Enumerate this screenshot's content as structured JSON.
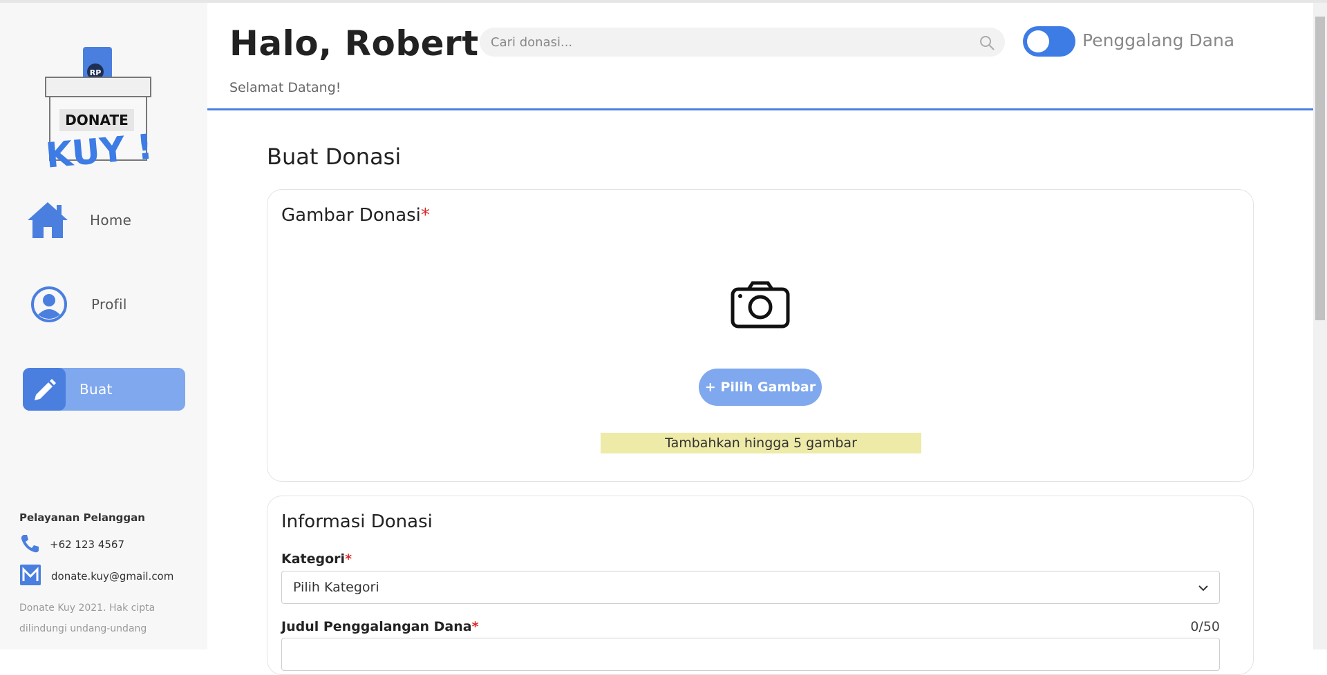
{
  "sidebar": {
    "logo": {
      "top_text": "DONATE",
      "brand_text": "KUY !",
      "coin_text": "RP"
    },
    "nav": [
      {
        "label": "Home",
        "icon": "home-icon"
      },
      {
        "label": "Profil",
        "icon": "user-icon"
      },
      {
        "label": "Buat",
        "icon": "pencil-icon"
      }
    ],
    "customer_service": {
      "title": "Pelayanan Pelanggan",
      "phone": "+62 123 4567",
      "email": "donate.kuy@gmail.com"
    },
    "copyright": "Donate Kuy 2021. Hak cipta dilindungi undang-undang"
  },
  "header": {
    "greeting": "Halo, Robert",
    "welcome": "Selamat Datang!",
    "search_placeholder": "Cari donasi...",
    "toggle_label": "Penggalang Dana",
    "toggle_on": true
  },
  "main": {
    "title": "Buat Donasi",
    "image_card": {
      "title": "Gambar Donasi",
      "required_mark": "*",
      "button_label": "+ Pilih Gambar",
      "hint": "Tambahkan hingga 5 gambar"
    },
    "info_card": {
      "title": "Informasi Donasi",
      "category_label": "Kategori",
      "category_required": "*",
      "category_value": "Pilih Kategori",
      "title_label": "Judul Penggalangan Dana",
      "title_required": "*",
      "title_counter": "0/50"
    }
  },
  "colors": {
    "accent": "#4a7fdf",
    "accent_light": "#7fa8ee",
    "required": "#e02424",
    "hint_bg": "#eeeaa8"
  }
}
